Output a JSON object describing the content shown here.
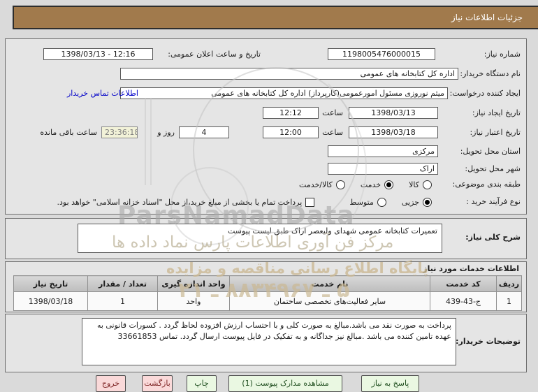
{
  "title_bar": {
    "text": "جزئیات اطلاعات نیاز"
  },
  "form": {
    "need_number": {
      "label": "شماره نیاز:",
      "value": "1198005476000015"
    },
    "announce_datetime": {
      "label": "تاریخ و ساعت اعلان عمومی:",
      "value": "1398/03/13 - 12:16"
    },
    "buyer_org": {
      "label": "نام دستگاه خریدار:",
      "value": "اداره کل کتابخانه های عمومی"
    },
    "request_creator": {
      "label": "ایجاد کننده درخواست:",
      "value": "میثم نوروزی مسئول امورعمومی(کارپرداز) اداره کل کتابخانه های عمومی",
      "contact_link": "اطلاعات تماس خریدار"
    },
    "create_date": {
      "label": "تاریخ ایجاد نیاز:",
      "date": "1398/03/13",
      "hour_label": "ساعت",
      "time": "12:12"
    },
    "expire_date": {
      "label": "تاریخ اعتبار نیاز:",
      "date": "1398/03/18",
      "hour_label": "ساعت",
      "time": "12:00",
      "days_value": "4",
      "days_label": "روز و",
      "remaining_time": "23:36:18",
      "remaining_label": "ساعت باقی مانده"
    },
    "province": {
      "label": "استان محل تحویل:",
      "value": "مرکزی"
    },
    "city": {
      "label": "شهر محل تحویل:",
      "value": "اراک"
    },
    "category": {
      "label": "طبقه بندی موضوعی:",
      "options": [
        {
          "label": "کالا",
          "checked": false
        },
        {
          "label": "خدمت",
          "checked": true
        },
        {
          "label": "کالا/خدمت",
          "checked": false
        }
      ]
    },
    "process_type": {
      "label": "نوع فرآیند خرید :",
      "options": [
        {
          "label": "جزیی",
          "checked": true
        },
        {
          "label": "متوسط",
          "checked": false
        }
      ],
      "treasury_checkbox": {
        "checked": false,
        "label": "پرداخت تمام یا بخشی از مبلغ خرید،از محل \"اسناد خزانه اسلامی\" خواهد بود."
      }
    }
  },
  "description": {
    "label": "شرح کلی نیاز:",
    "value": "تعمیرات کتابخانه عمومی شهدای ولیعصر اراک طبق لیست پیوست"
  },
  "services": {
    "header": "اطلاعات خدمات مورد نیاز",
    "table": {
      "columns": [
        "ردیف",
        "کد خدمت",
        "نام خدمت",
        "واحد اندازه گیری",
        "تعداد / مقدار",
        "تاریخ نیاز"
      ],
      "rows": [
        [
          "1",
          "ج-43-439",
          "سایر فعالیت‌های تخصصی ساختمان",
          "واحد",
          "1",
          "1398/03/18"
        ]
      ]
    }
  },
  "notes": {
    "label": "توضیحات خریدار:",
    "value": "پرداخت به صورت نقد می باشد.مبالغ به صورت کلی و با احتساب ارزش افزوده لحاظ گردد . کسورات قانونی به عهده تامین کننده می باشد .مبالغ نیز جداگانه و به تفکیک در فایل پیوست ارسال گردد. تماس 33661853"
  },
  "footer": {
    "buttons": [
      {
        "label": "پاسخ به نیاز",
        "style": "green"
      },
      {
        "label": "مشاهده مدارک پیوست (1)",
        "style": "green"
      },
      {
        "label": "چاپ",
        "style": "green"
      },
      {
        "label": "بازگشت",
        "style": "pink"
      },
      {
        "label": "خروج",
        "style": "pink"
      }
    ]
  },
  "watermark": {
    "latin": "ParsNamadData",
    "line1": "مرکز فن آوری اطلاعات پارس نماد داده ها",
    "line2": "پایگاه اطلاع رسانی مناقصه و مزایده",
    "phone": "۵ ـ ۸۸۳۴۹۶۷ ـ ۲۱"
  },
  "colors": {
    "title_bar": "#a17a4c",
    "link": "#0000c8",
    "countdown_bg": "#f2f2d8",
    "button_green": "#eaf8e2",
    "button_pink": "#fad9d9"
  }
}
